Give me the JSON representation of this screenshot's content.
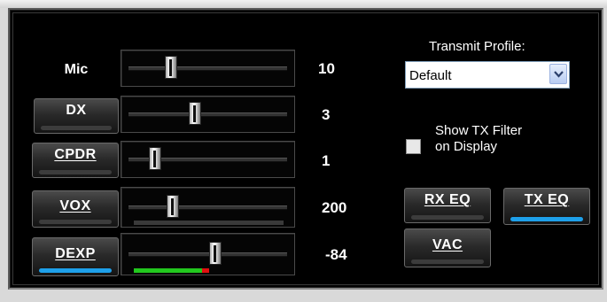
{
  "controls": {
    "mic": {
      "label": "Mic",
      "value_text": "10",
      "position": 0.27
    },
    "dx": {
      "label": "DX",
      "value_text": "3",
      "position": 0.42,
      "active": false
    },
    "cpdr": {
      "label": "CPDR",
      "value_text": "1",
      "position": 0.17,
      "active": false
    },
    "vox": {
      "label": "VOX",
      "value_text": "200",
      "position": 0.28,
      "active": false
    },
    "dexp": {
      "label": "DEXP",
      "value_text": "-84",
      "position": 0.55,
      "active": true,
      "meter": {
        "green": 0.46,
        "red": 0.05
      }
    }
  },
  "transmit_profile": {
    "label": "Transmit Profile:",
    "selected": "Default"
  },
  "tx_filter": {
    "label_line1": "Show TX Filter",
    "label_line2": "on Display",
    "checked": false
  },
  "eq_buttons": {
    "rx_eq": {
      "label": "RX EQ",
      "active": false
    },
    "tx_eq": {
      "label": "TX EQ",
      "active": true
    },
    "vac": {
      "label": "VAC",
      "active": false
    }
  },
  "colors": {
    "indicator_on": "#1ea0ea",
    "meter_green": "#22c81e",
    "meter_red": "#e01010",
    "panel_bg": "#000000"
  },
  "icons": {
    "combo_arrow": "chevron-down-icon"
  }
}
